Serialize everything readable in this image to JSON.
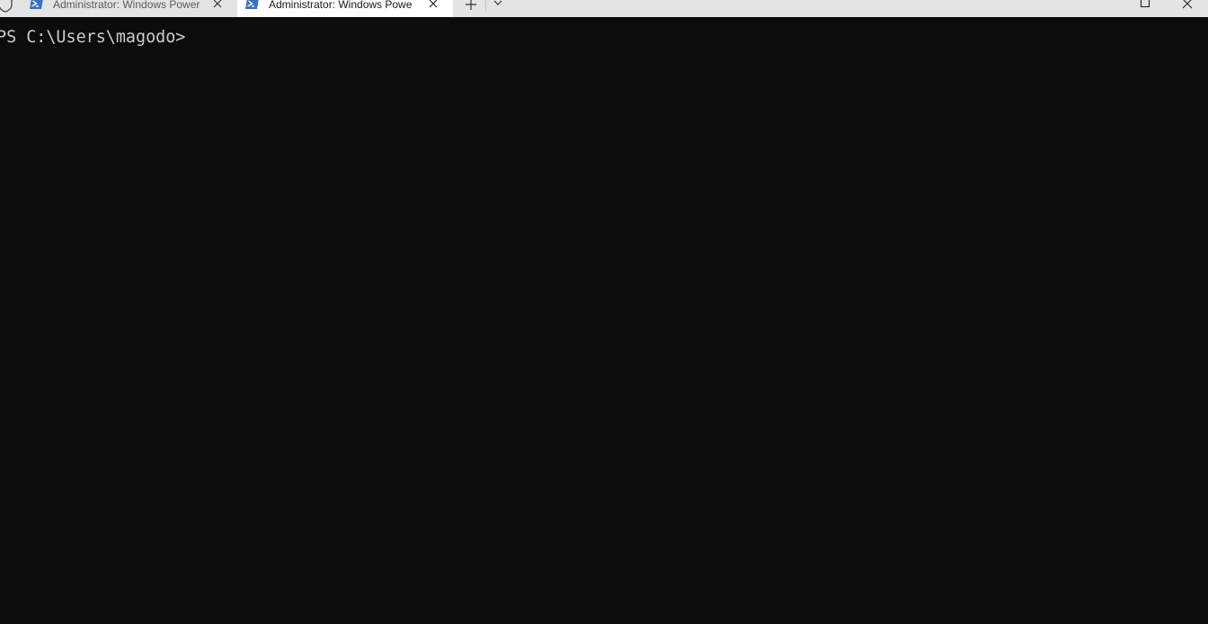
{
  "window": {
    "accent_color": "#0c0c0c"
  },
  "tabs": [
    {
      "title": "Administrator: Windows Power",
      "active": false,
      "icon": "powershell-icon"
    },
    {
      "title": "Administrator: Windows Powe",
      "active": true,
      "icon": "powershell-icon"
    }
  ],
  "icons": {
    "admin": "shield-icon",
    "new_tab": "plus-icon",
    "dropdown": "chevron-down-icon",
    "maximize": "maximize-icon",
    "close": "close-icon"
  },
  "terminal": {
    "prompt": "PS C:\\Users\\magodo>",
    "text_color": "#cccccc",
    "background": "#0c0c0c"
  }
}
